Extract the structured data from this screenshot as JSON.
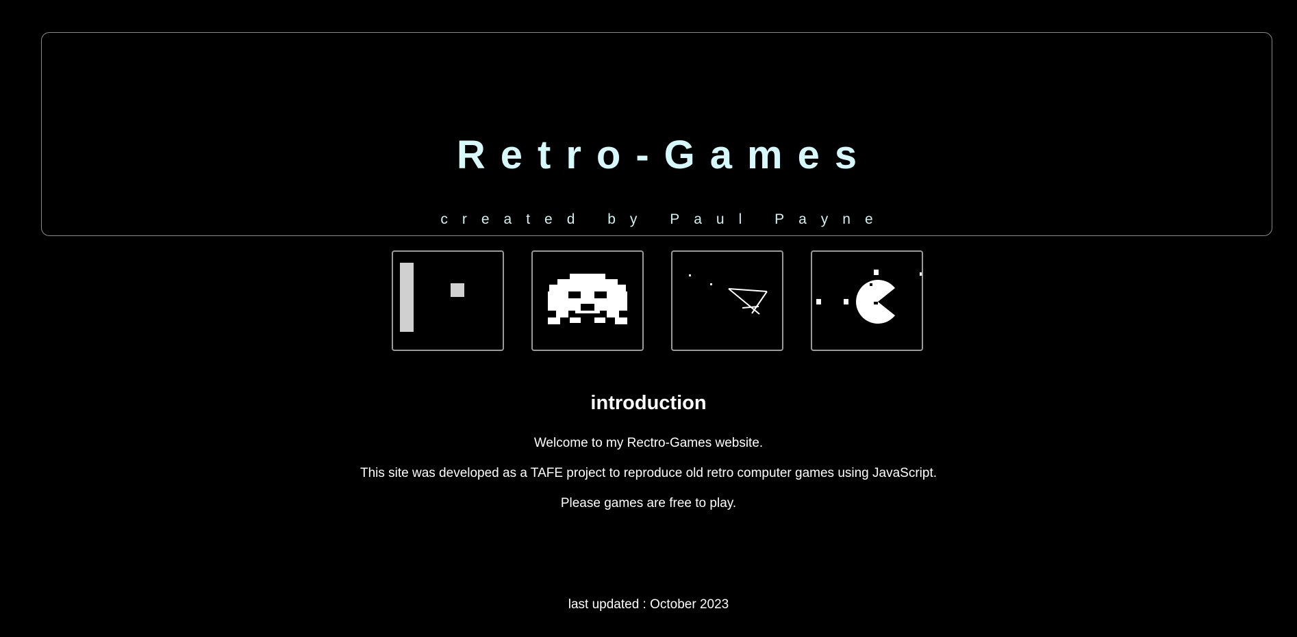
{
  "header": {
    "title": "Retro-Games",
    "subtitle": "created by Paul Payne"
  },
  "games": [
    {
      "icon": "pong-icon"
    },
    {
      "icon": "space-invaders-icon"
    },
    {
      "icon": "asteroids-icon"
    },
    {
      "icon": "pacman-icon"
    }
  ],
  "intro": {
    "heading": "introduction",
    "lines": [
      "Welcome to my Rectro-Games website.",
      "This site was developed as a TAFE project to reproduce old retro computer games using JavaScript.",
      "Please games are free to play."
    ]
  },
  "footer": {
    "text": "last updated : October 2023"
  },
  "colors": {
    "background": "#000000",
    "title": "#d6fafc",
    "border": "#8a8a8a"
  }
}
